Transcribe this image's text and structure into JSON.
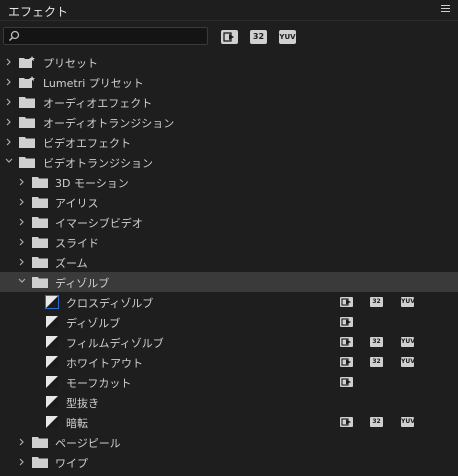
{
  "panel": {
    "title": "エフェクト"
  },
  "search": {
    "value": "",
    "placeholder": ""
  },
  "filter_buttons": [
    {
      "label": "",
      "icon": "accelerated-effects-icon"
    },
    {
      "label": "32",
      "icon": "32bit-icon"
    },
    {
      "label": "YUV",
      "icon": "yuv-icon"
    }
  ],
  "badges": {
    "accel": "",
    "b32": "32",
    "yuv": "YUV"
  },
  "tree": {
    "presets": "プリセット",
    "lumetri_presets": "Lumetri プリセット",
    "audio_effects": "オーディオエフェクト",
    "audio_transitions": "オーディオトランジション",
    "video_effects": "ビデオエフェクト",
    "video_transitions": "ビデオトランジション",
    "sub": {
      "motion3d": "3D モーション",
      "iris": "アイリス",
      "immersive": "イマーシブビデオ",
      "slide": "スライド",
      "zoom": "ズーム",
      "dissolve": "ディゾルブ",
      "page_peel": "ページピール",
      "wipe": "ワイプ"
    },
    "dissolve_items": {
      "cross": "クロスディゾルブ",
      "dissolve": "ディゾルブ",
      "film": "フィルムディゾルブ",
      "white": "ホワイトアウト",
      "morph": "モーフカット",
      "mold": "型抜き",
      "dark": "暗転"
    }
  },
  "colors": {
    "background": "#1e1e1e",
    "selected_row": "#3a3a3a",
    "focus_outline": "#2a6bd8"
  }
}
